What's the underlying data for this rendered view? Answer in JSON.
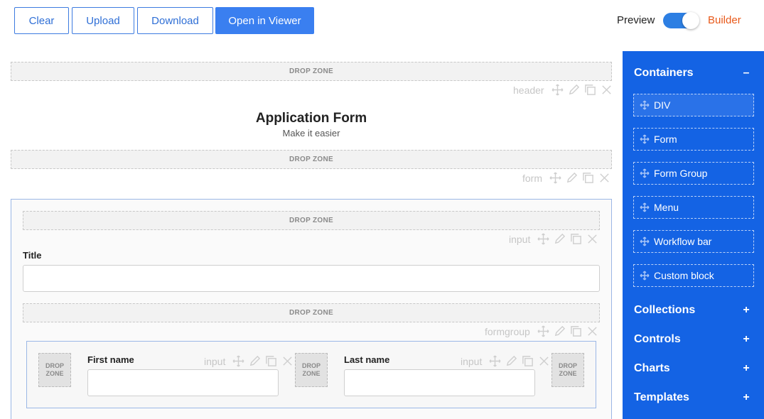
{
  "toolbar": {
    "clear": "Clear",
    "upload": "Upload",
    "download": "Download",
    "open_viewer": "Open in Viewer",
    "preview": "Preview",
    "builder": "Builder"
  },
  "canvas": {
    "drop_zone": "DROP ZONE",
    "drop_zone_small_line1": "DROP",
    "drop_zone_small_line2": "ZONE",
    "tag_header": "header",
    "tag_form": "form",
    "tag_input": "input",
    "tag_formgroup": "formgroup",
    "form_title": "Application Form",
    "form_subtitle": "Make it easier",
    "title_label": "Title",
    "first_name_label": "First name",
    "last_name_label": "Last name"
  },
  "sidebar": {
    "containers": "Containers",
    "containers_sign": "–",
    "items": [
      "DIV",
      "Form",
      "Form Group",
      "Menu",
      "Workflow bar",
      "Custom block"
    ],
    "collections": "Collections",
    "controls": "Controls",
    "charts": "Charts",
    "templates": "Templates",
    "plus": "+"
  },
  "colors": {
    "accent": "#1463e4",
    "builder": "#e8591a",
    "button": "#3a7ff0"
  },
  "icons": [
    "move-icon",
    "edit-icon",
    "copy-icon",
    "close-icon"
  ]
}
